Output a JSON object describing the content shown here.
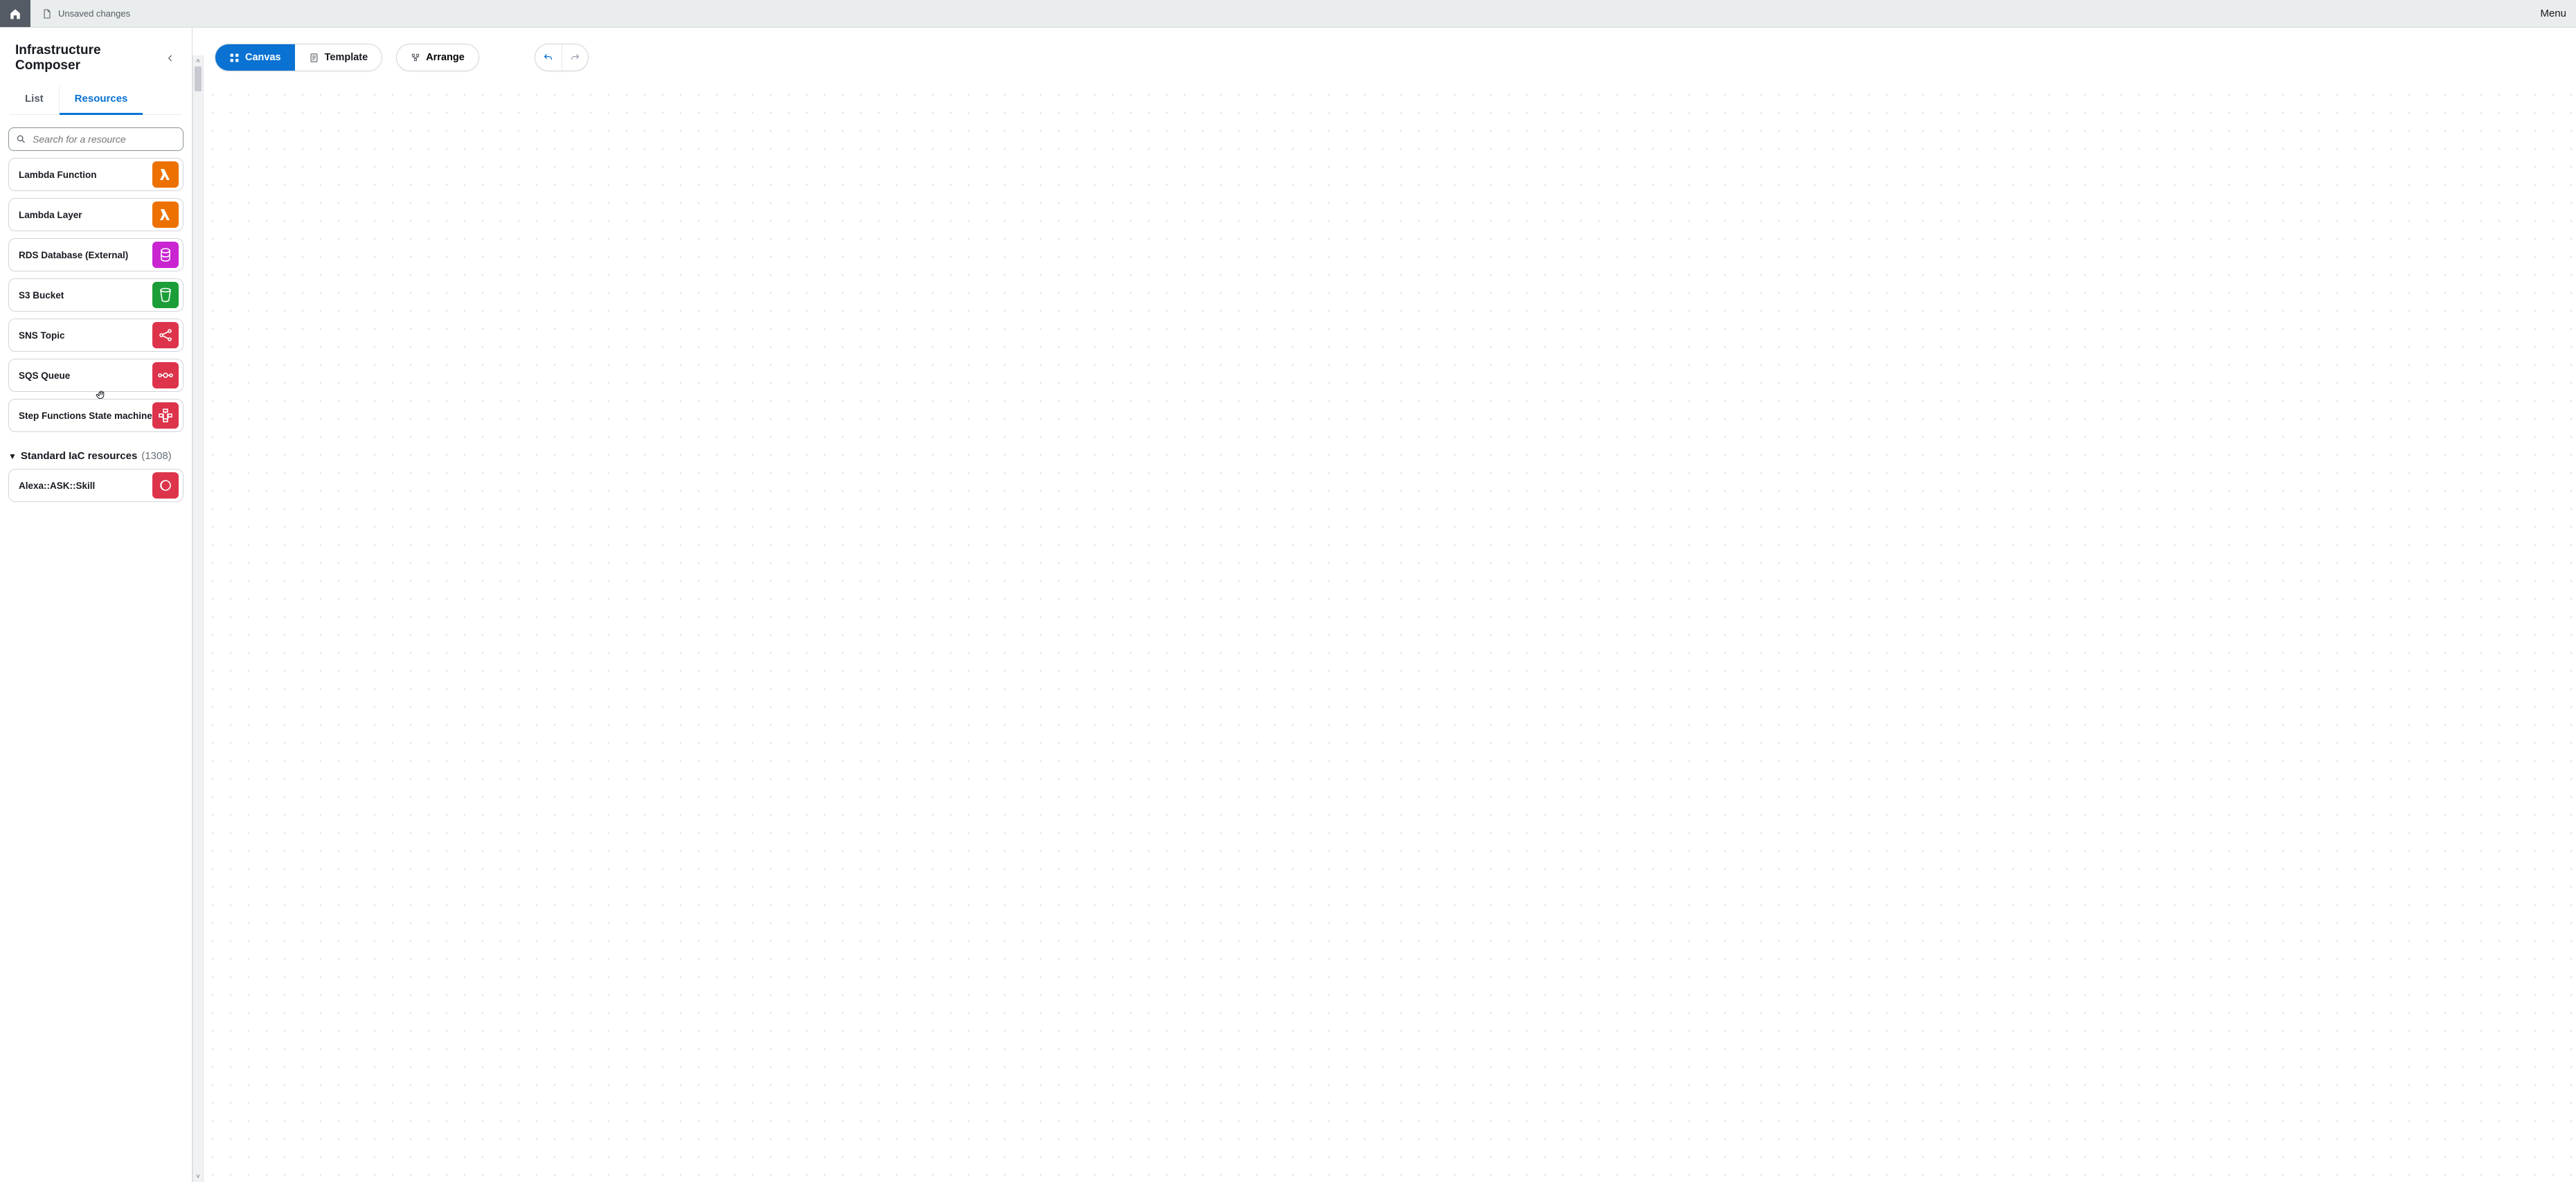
{
  "topbar": {
    "unsaved_label": "Unsaved changes",
    "menu_label": "Menu"
  },
  "sidebar": {
    "title": "Infrastructure Composer",
    "tabs": {
      "list": "List",
      "resources": "Resources"
    },
    "search_placeholder": "Search for a resource",
    "resources": [
      {
        "label": "Lambda Function"
      },
      {
        "label": "Lambda Layer"
      },
      {
        "label": "RDS Database (External)"
      },
      {
        "label": "S3 Bucket"
      },
      {
        "label": "SNS Topic"
      },
      {
        "label": "SQS Queue"
      },
      {
        "label": "Step Functions State machine"
      }
    ],
    "section": {
      "title": "Standard IaC resources",
      "count": "(1308)"
    },
    "std_resources": [
      {
        "label": "Alexa::ASK::Skill"
      }
    ]
  },
  "toolbar": {
    "canvas": "Canvas",
    "template": "Template",
    "arrange": "Arrange"
  }
}
